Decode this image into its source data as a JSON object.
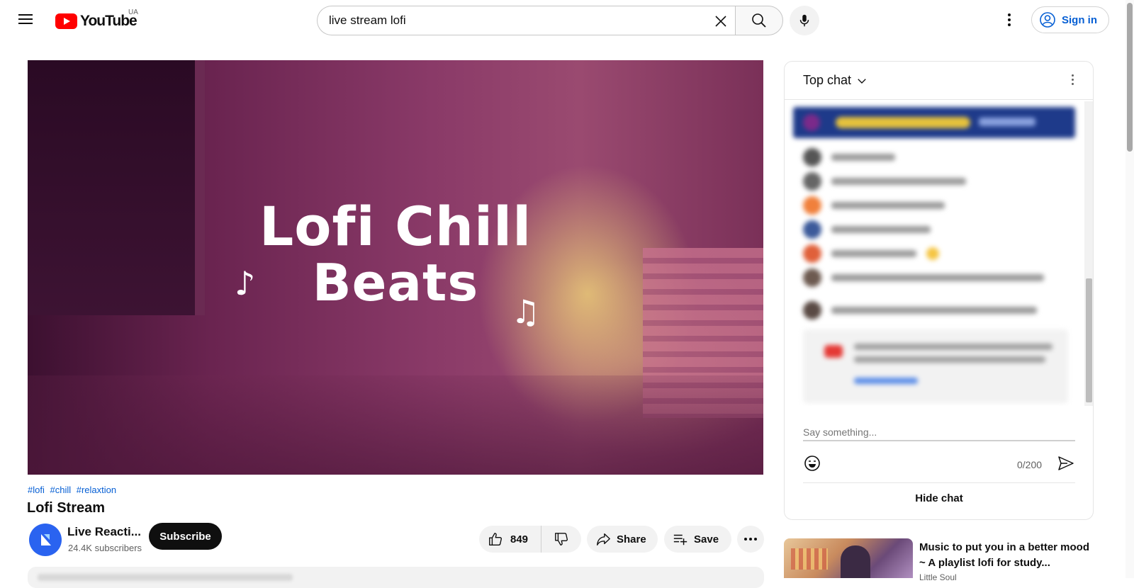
{
  "header": {
    "logo_text": "YouTube",
    "country_code": "UA",
    "search_value": "live stream lofi",
    "signin_label": "Sign in"
  },
  "video": {
    "overlay_line1": "Lofi Chill",
    "overlay_line2": "Beats",
    "hashtags": [
      "#lofi",
      "#chill",
      "#relaxtion"
    ],
    "title": "Lofi Stream",
    "channel_name": "Live Reacti...",
    "subscribers": "24.4K subscribers",
    "subscribe_label": "Subscribe",
    "like_count": "849",
    "share_label": "Share",
    "save_label": "Save"
  },
  "chat": {
    "mode_label": "Top chat",
    "input_placeholder": "Say something...",
    "char_counter": "0/200",
    "hide_label": "Hide chat"
  },
  "recommendation": {
    "title": "Music to put you in a better mood ~ A playlist lofi for study...",
    "channel": "Little Soul"
  },
  "colors": {
    "accent_blue": "#065fd4",
    "youtube_red": "#ff0000"
  }
}
